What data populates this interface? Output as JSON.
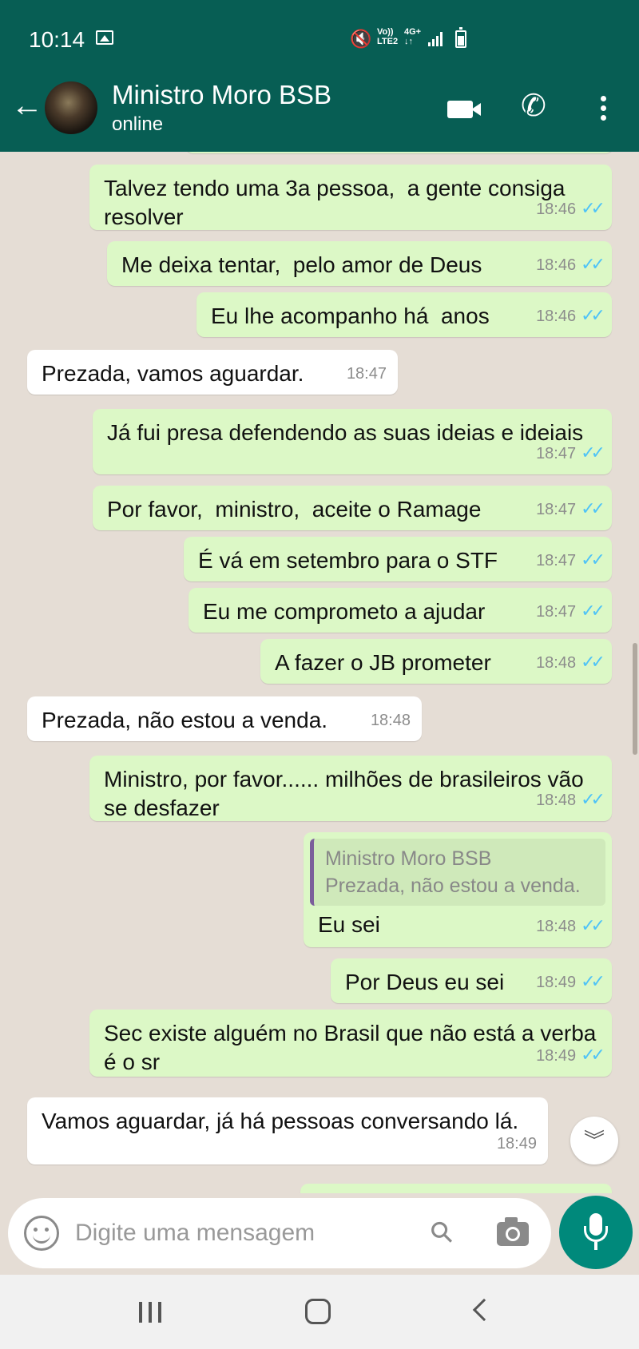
{
  "status_bar": {
    "time": "10:14",
    "network_top": "Vo))",
    "network_bottom": "LTE2",
    "net_type_top": "4G+",
    "net_type_bottom": "↓↑"
  },
  "header": {
    "contact_name": "Ministro Moro BSB",
    "status": "online"
  },
  "messages": [
    {
      "dir": "out",
      "text": "Talvez tendo uma 3a pessoa,  a gente consiga resolver",
      "time": "18:46",
      "ticks": "✓✓"
    },
    {
      "dir": "out",
      "text": "Me deixa tentar,  pelo amor de Deus",
      "time": "18:46",
      "ticks": "✓✓"
    },
    {
      "dir": "out",
      "text": "Eu lhe acompanho há  anos",
      "time": "18:46",
      "ticks": "✓✓"
    },
    {
      "dir": "in",
      "text": "Prezada, vamos aguardar.",
      "time": "18:47"
    },
    {
      "dir": "out",
      "text": "Já fui presa defendendo as suas ideias e ideiais",
      "time": "18:47",
      "ticks": "✓✓"
    },
    {
      "dir": "out",
      "text": "Por favor,  ministro,  aceite o Ramage",
      "time": "18:47",
      "ticks": "✓✓"
    },
    {
      "dir": "out",
      "text": "É vá em setembro para o STF",
      "time": "18:47",
      "ticks": "✓✓"
    },
    {
      "dir": "out",
      "text": "Eu me comprometo a ajudar",
      "time": "18:47",
      "ticks": "✓✓"
    },
    {
      "dir": "out",
      "text": "A fazer o JB prometer",
      "time": "18:48",
      "ticks": "✓✓"
    },
    {
      "dir": "in",
      "text": "Prezada, não estou a venda.",
      "time": "18:48"
    },
    {
      "dir": "out",
      "text": "Ministro, por favor...... milhões de brasileiros vão se desfazer",
      "time": "18:48",
      "ticks": "✓✓"
    },
    {
      "dir": "out",
      "quote_name": "Ministro Moro BSB",
      "quote_text": "Prezada, não estou a venda.",
      "text": "Eu sei",
      "time": "18:48",
      "ticks": "✓✓"
    },
    {
      "dir": "out",
      "text": "Por Deus eu sei",
      "time": "18:49",
      "ticks": "✓✓"
    },
    {
      "dir": "out",
      "text": "Sec existe alguém no Brasil que não está a verba é o sr",
      "time": "18:49",
      "ticks": "✓✓"
    },
    {
      "dir": "in",
      "text": "Vamos aguardar, já há pessoas conversando lá.",
      "time": "18:49"
    }
  ],
  "composer": {
    "placeholder": "Digite uma mensagem"
  },
  "colors": {
    "header": "#075e54",
    "outgoing_bubble": "#dcf8c6",
    "incoming_bubble": "#ffffff",
    "read_ticks": "#4fc3f7",
    "mic_button": "#00897b"
  }
}
